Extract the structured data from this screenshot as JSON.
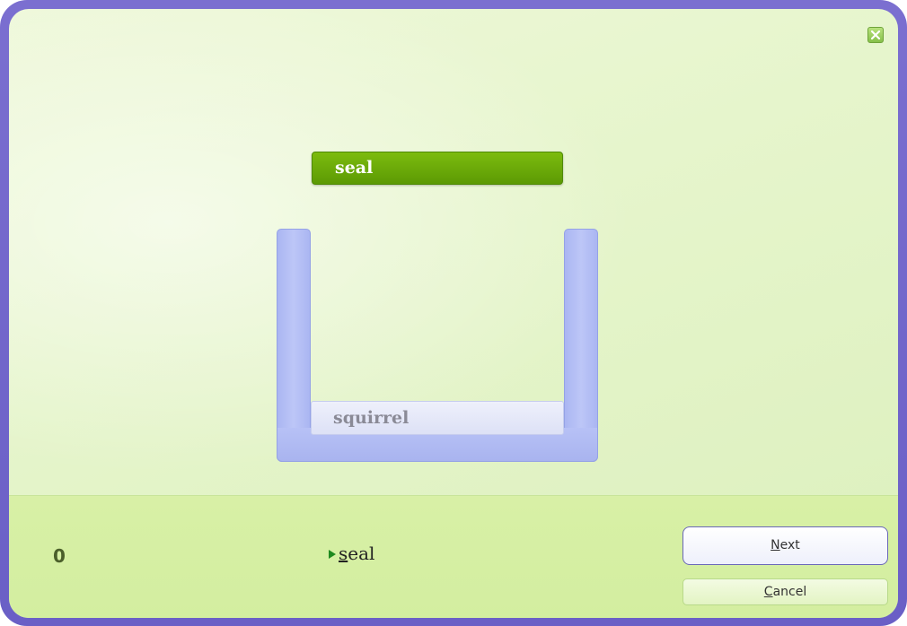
{
  "window": {
    "close_icon": "close-x-icon"
  },
  "activity": {
    "drag_word": "seal",
    "bucket_word": "squirrel"
  },
  "footer": {
    "score": "0",
    "current_word_first": "s",
    "current_word_rest": "eal",
    "play_icon": "play-triangle-icon",
    "next_first": "N",
    "next_rest": "ext",
    "cancel_first": "C",
    "cancel_rest": "ancel"
  },
  "colors": {
    "frame": "#6a5fc6",
    "background": "#e6f5cc",
    "drag_word_bg": "#5c9a04",
    "bucket": "#aab6f2",
    "footer_bg": "#d3eea0"
  }
}
